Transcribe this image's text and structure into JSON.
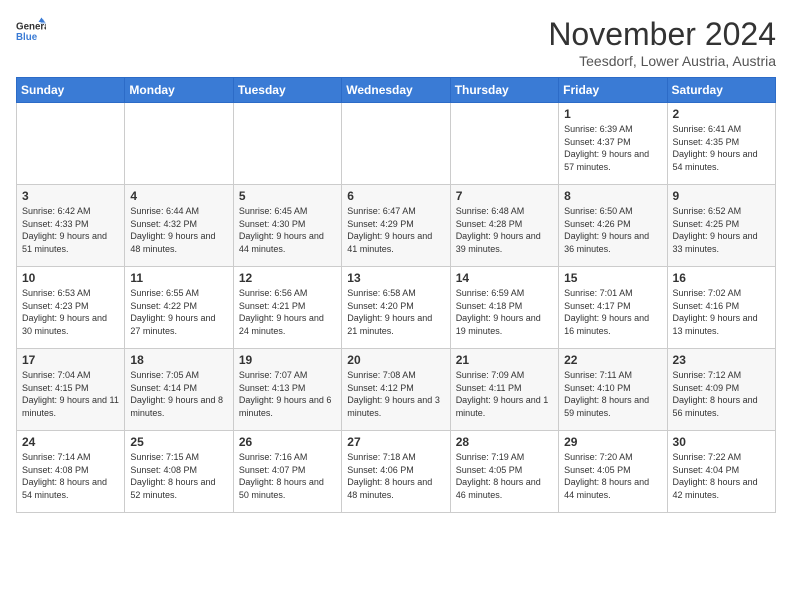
{
  "header": {
    "logo_line1": "General",
    "logo_line2": "Blue",
    "month_title": "November 2024",
    "location": "Teesdorf, Lower Austria, Austria"
  },
  "weekdays": [
    "Sunday",
    "Monday",
    "Tuesday",
    "Wednesday",
    "Thursday",
    "Friday",
    "Saturday"
  ],
  "weeks": [
    [
      {
        "day": "",
        "info": ""
      },
      {
        "day": "",
        "info": ""
      },
      {
        "day": "",
        "info": ""
      },
      {
        "day": "",
        "info": ""
      },
      {
        "day": "",
        "info": ""
      },
      {
        "day": "1",
        "info": "Sunrise: 6:39 AM\nSunset: 4:37 PM\nDaylight: 9 hours and 57 minutes."
      },
      {
        "day": "2",
        "info": "Sunrise: 6:41 AM\nSunset: 4:35 PM\nDaylight: 9 hours and 54 minutes."
      }
    ],
    [
      {
        "day": "3",
        "info": "Sunrise: 6:42 AM\nSunset: 4:33 PM\nDaylight: 9 hours and 51 minutes."
      },
      {
        "day": "4",
        "info": "Sunrise: 6:44 AM\nSunset: 4:32 PM\nDaylight: 9 hours and 48 minutes."
      },
      {
        "day": "5",
        "info": "Sunrise: 6:45 AM\nSunset: 4:30 PM\nDaylight: 9 hours and 44 minutes."
      },
      {
        "day": "6",
        "info": "Sunrise: 6:47 AM\nSunset: 4:29 PM\nDaylight: 9 hours and 41 minutes."
      },
      {
        "day": "7",
        "info": "Sunrise: 6:48 AM\nSunset: 4:28 PM\nDaylight: 9 hours and 39 minutes."
      },
      {
        "day": "8",
        "info": "Sunrise: 6:50 AM\nSunset: 4:26 PM\nDaylight: 9 hours and 36 minutes."
      },
      {
        "day": "9",
        "info": "Sunrise: 6:52 AM\nSunset: 4:25 PM\nDaylight: 9 hours and 33 minutes."
      }
    ],
    [
      {
        "day": "10",
        "info": "Sunrise: 6:53 AM\nSunset: 4:23 PM\nDaylight: 9 hours and 30 minutes."
      },
      {
        "day": "11",
        "info": "Sunrise: 6:55 AM\nSunset: 4:22 PM\nDaylight: 9 hours and 27 minutes."
      },
      {
        "day": "12",
        "info": "Sunrise: 6:56 AM\nSunset: 4:21 PM\nDaylight: 9 hours and 24 minutes."
      },
      {
        "day": "13",
        "info": "Sunrise: 6:58 AM\nSunset: 4:20 PM\nDaylight: 9 hours and 21 minutes."
      },
      {
        "day": "14",
        "info": "Sunrise: 6:59 AM\nSunset: 4:18 PM\nDaylight: 9 hours and 19 minutes."
      },
      {
        "day": "15",
        "info": "Sunrise: 7:01 AM\nSunset: 4:17 PM\nDaylight: 9 hours and 16 minutes."
      },
      {
        "day": "16",
        "info": "Sunrise: 7:02 AM\nSunset: 4:16 PM\nDaylight: 9 hours and 13 minutes."
      }
    ],
    [
      {
        "day": "17",
        "info": "Sunrise: 7:04 AM\nSunset: 4:15 PM\nDaylight: 9 hours and 11 minutes."
      },
      {
        "day": "18",
        "info": "Sunrise: 7:05 AM\nSunset: 4:14 PM\nDaylight: 9 hours and 8 minutes."
      },
      {
        "day": "19",
        "info": "Sunrise: 7:07 AM\nSunset: 4:13 PM\nDaylight: 9 hours and 6 minutes."
      },
      {
        "day": "20",
        "info": "Sunrise: 7:08 AM\nSunset: 4:12 PM\nDaylight: 9 hours and 3 minutes."
      },
      {
        "day": "21",
        "info": "Sunrise: 7:09 AM\nSunset: 4:11 PM\nDaylight: 9 hours and 1 minute."
      },
      {
        "day": "22",
        "info": "Sunrise: 7:11 AM\nSunset: 4:10 PM\nDaylight: 8 hours and 59 minutes."
      },
      {
        "day": "23",
        "info": "Sunrise: 7:12 AM\nSunset: 4:09 PM\nDaylight: 8 hours and 56 minutes."
      }
    ],
    [
      {
        "day": "24",
        "info": "Sunrise: 7:14 AM\nSunset: 4:08 PM\nDaylight: 8 hours and 54 minutes."
      },
      {
        "day": "25",
        "info": "Sunrise: 7:15 AM\nSunset: 4:08 PM\nDaylight: 8 hours and 52 minutes."
      },
      {
        "day": "26",
        "info": "Sunrise: 7:16 AM\nSunset: 4:07 PM\nDaylight: 8 hours and 50 minutes."
      },
      {
        "day": "27",
        "info": "Sunrise: 7:18 AM\nSunset: 4:06 PM\nDaylight: 8 hours and 48 minutes."
      },
      {
        "day": "28",
        "info": "Sunrise: 7:19 AM\nSunset: 4:05 PM\nDaylight: 8 hours and 46 minutes."
      },
      {
        "day": "29",
        "info": "Sunrise: 7:20 AM\nSunset: 4:05 PM\nDaylight: 8 hours and 44 minutes."
      },
      {
        "day": "30",
        "info": "Sunrise: 7:22 AM\nSunset: 4:04 PM\nDaylight: 8 hours and 42 minutes."
      }
    ]
  ]
}
